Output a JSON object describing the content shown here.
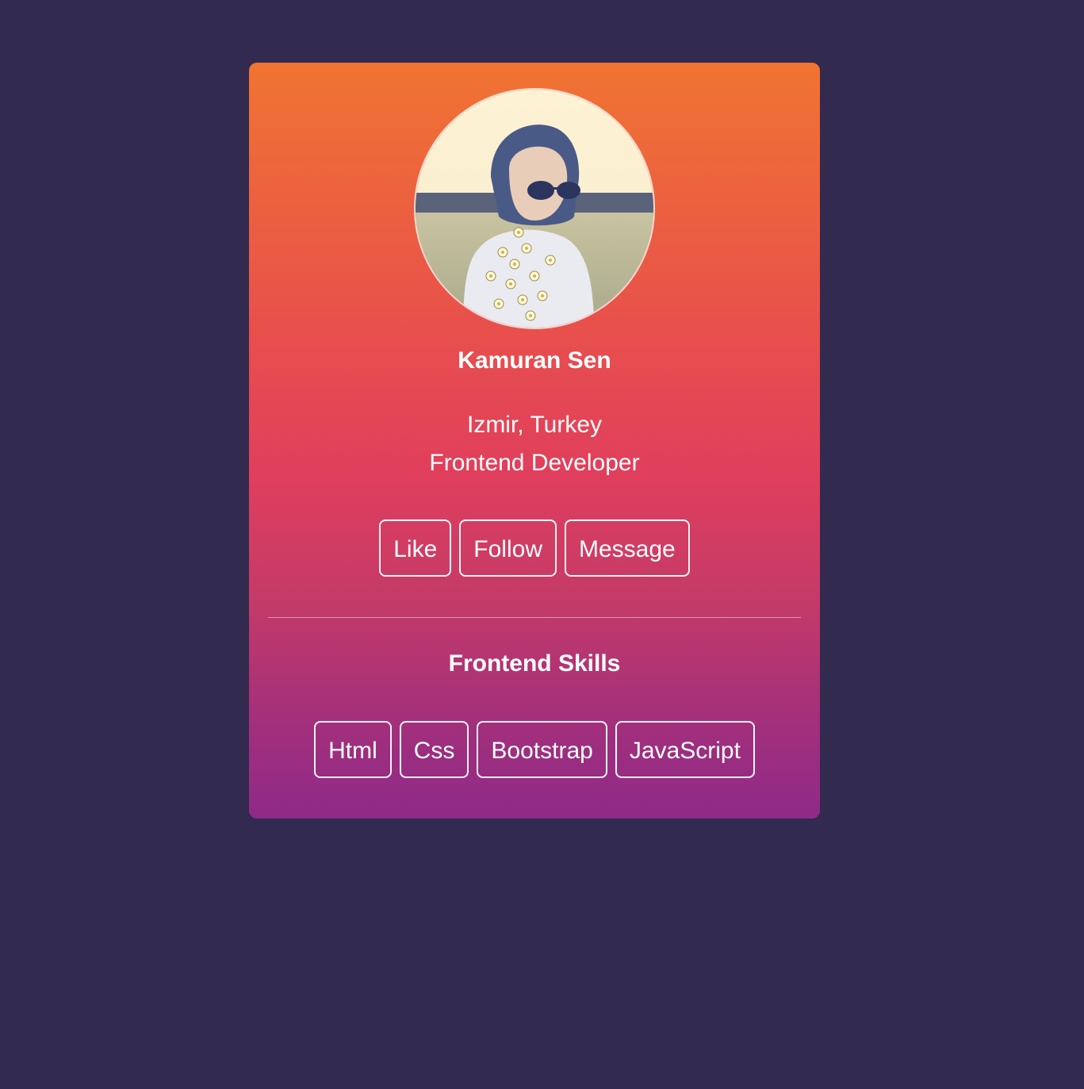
{
  "profile": {
    "name": "Kamuran Sen",
    "location": "Izmir, Turkey",
    "role": "Frontend Developer",
    "avatar_alt": "profile photo"
  },
  "actions": [
    {
      "label": "Like"
    },
    {
      "label": "Follow"
    },
    {
      "label": "Message"
    }
  ],
  "skills": {
    "title": "Frontend Skills",
    "items": [
      {
        "label": "Html"
      },
      {
        "label": "Css"
      },
      {
        "label": "Bootstrap"
      },
      {
        "label": "JavaScript"
      }
    ]
  },
  "colors": {
    "page_background": "#322a4f",
    "card_gradient_top": "#f07431",
    "card_gradient_bottom": "#8e2a88",
    "text": "#ffffff"
  }
}
